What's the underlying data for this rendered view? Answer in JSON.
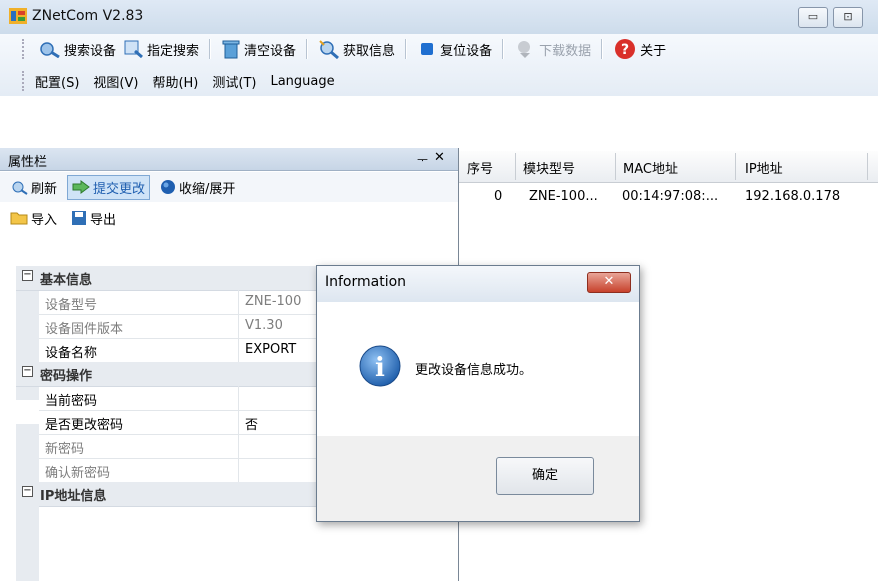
{
  "window": {
    "title": "ZNetCom V2.83",
    "minimize_label": "▭",
    "maximize_label": "⊡"
  },
  "toolbar": {
    "buttons": [
      {
        "label": "搜索设备",
        "icon": "search-device-icon"
      },
      {
        "label": "指定搜索",
        "icon": "magnifier-icon"
      },
      {
        "label": "清空设备",
        "icon": "trash-icon"
      },
      {
        "label": "获取信息",
        "icon": "get-info-icon"
      },
      {
        "label": "复位设备",
        "icon": "reset-square-icon"
      },
      {
        "label": "下载数据",
        "icon": "download-icon",
        "disabled": true
      },
      {
        "label": "关于",
        "icon": "help-icon"
      }
    ]
  },
  "menu": {
    "items": [
      "配置(S)",
      "视图(V)",
      "帮助(H)",
      "测试(T)",
      "Language"
    ]
  },
  "properties_panel": {
    "title": "属性栏",
    "pin": "ᅮ",
    "close": "✕",
    "tools": {
      "refresh": "刷新",
      "submit": "提交更改",
      "collapse": "收缩/展开"
    },
    "io": {
      "import": "导入",
      "export": "导出"
    },
    "categories": {
      "basic": "基本信息",
      "password": "密码操作",
      "ip": "IP地址信息"
    },
    "toggle": "−",
    "rows": {
      "model_key": "设备型号",
      "model_val": "ZNE-100",
      "fw_key": "设备固件版本",
      "fw_val": "V1.30",
      "name_key": "设备名称",
      "name_val": "EXPORT",
      "curpwd_key": "当前密码",
      "curpwd_val": "",
      "changepwd_key": "是否更改密码",
      "changepwd_val": "否",
      "newpwd_key": "新密码",
      "newpwd_val": "",
      "confirmpwd_key": "确认新密码",
      "confirmpwd_val": ""
    }
  },
  "device_list": {
    "columns": [
      "序号",
      "模块型号",
      "MAC地址",
      "IP地址"
    ],
    "rows": [
      {
        "index": "0",
        "model": "ZNE-100...",
        "mac": "00:14:97:08:...",
        "ip": "192.168.0.178"
      }
    ]
  },
  "dialog": {
    "title": "Information",
    "close": "✕",
    "message": "更改设备信息成功。",
    "ok_label": "确定",
    "info_symbol": "i"
  },
  "colors": {
    "accent": "#1f5fb0",
    "titlebar": "#d5e1ee",
    "close_red": "#c7422c"
  }
}
